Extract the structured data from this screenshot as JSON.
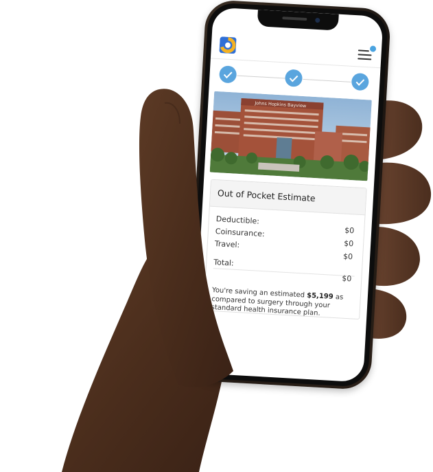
{
  "header": {
    "menu_icon": "hamburger-menu-icon",
    "logo_icon": "app-logo-icon",
    "notification_color": "#4aa3e0"
  },
  "steps": {
    "count": 3,
    "completed": 3,
    "icon": "check-icon",
    "color": "#5aa5de"
  },
  "photo": {
    "sign_text": "Johns Hopkins Bayview"
  },
  "estimate": {
    "title": "Out of Pocket Estimate",
    "rows": [
      {
        "label": "Deductible:",
        "value": "$0"
      },
      {
        "label": "Coinsurance:",
        "value": "$0"
      },
      {
        "label": "Travel:",
        "value": "$0"
      }
    ],
    "total_label": "Total:",
    "total_value": "$0",
    "note_prefix": "You're saving an estimated",
    "note_amount": "$5,199",
    "note_suffix": "as compared to surgery through your standard health insurance plan."
  }
}
